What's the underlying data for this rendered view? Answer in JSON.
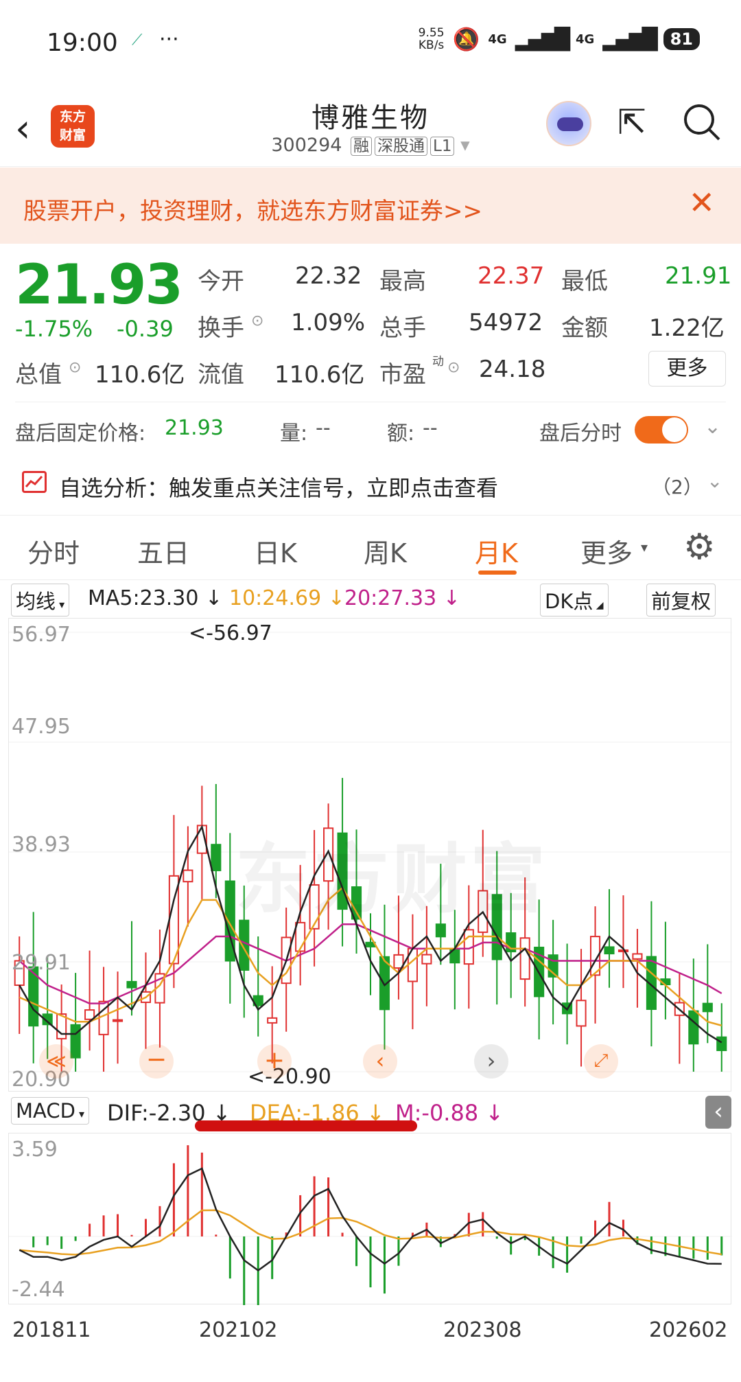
{
  "status": {
    "time": "19:00",
    "net_speed": "9.55\nKB/s",
    "sig1": "4G",
    "sig2": "4G",
    "battery": "81"
  },
  "header": {
    "name": "博雅生物",
    "code": "300294",
    "tags": [
      "融",
      "深股通",
      "L1"
    ],
    "logo_text": "东方\n财富"
  },
  "banner": {
    "text": "股票开户，投资理财，就选东方财富证券>>"
  },
  "quote": {
    "price": "21.93",
    "pct": "-1.75%",
    "chg": "-0.39",
    "open_label": "今开",
    "open": "22.32",
    "high_label": "最高",
    "high": "22.37",
    "low_label": "最低",
    "low": "21.91",
    "turnover_label": "换手",
    "turnover": "1.09%",
    "volume_label": "总手",
    "volume": "54972",
    "amount_label": "金额",
    "amount": "1.22亿",
    "mcap_label": "总值",
    "mcap": "110.6亿",
    "float_label": "流值",
    "float": "110.6亿",
    "pe_label": "市盈",
    "pe_sup": "动",
    "pe": "24.18",
    "more": "更多"
  },
  "after_hours": {
    "label": "盘后固定价格:",
    "price": "21.93",
    "vol_label": "量:",
    "vol": "--",
    "amt_label": "额:",
    "amt": "--",
    "toggle_label": "盘后分时"
  },
  "analysis": {
    "text": "自选分析：触发重点关注信号，立即点击查看",
    "count": "（2）"
  },
  "tabs": [
    "分时",
    "五日",
    "日K",
    "周K",
    "月K",
    "更多"
  ],
  "active_tab": "月K",
  "ma_bar": {
    "selector": "均线",
    "ma5": "MA5:23.30 ↓",
    "ma10": "10:24.69 ↓",
    "ma20": "20:27.33 ↓",
    "dk": "DK点",
    "fq": "前复权"
  },
  "price_axis": [
    "56.97",
    "47.95",
    "38.93",
    "29.91",
    "20.90"
  ],
  "annotations": {
    "high": "<-56.97",
    "low": "<-20.90"
  },
  "watermark": "东方财富",
  "macd_bar": {
    "selector": "MACD",
    "dif": "DIF:-2.30 ↓",
    "dea": "DEA:-1.86 ↓",
    "m": "M:-0.88 ↓"
  },
  "macd_axis": [
    "3.59",
    "-2.44"
  ],
  "x_axis": [
    "201811",
    "202102",
    "202308",
    "202602"
  ],
  "colors": {
    "up": "#e03030",
    "down": "#1a9e2a",
    "ma5": "#222222",
    "ma10": "#e8a020",
    "ma20": "#c0208a",
    "accent": "#f06a1a"
  },
  "chart_data": {
    "type": "candlestick",
    "ylim": [
      20.9,
      56.97
    ],
    "ma5": [
      28,
      26,
      25,
      24,
      24,
      25,
      26,
      27,
      26,
      28,
      30,
      35,
      39,
      41,
      36,
      32,
      28,
      26,
      27,
      30,
      34,
      37,
      39,
      36,
      33,
      30,
      28,
      29,
      31,
      32,
      30,
      31,
      33,
      34,
      32,
      30,
      31,
      29,
      27,
      26,
      28,
      30,
      32,
      31,
      29,
      28,
      27,
      26,
      25,
      24,
      23.3
    ],
    "ma10": [
      27,
      26.5,
      26,
      25.5,
      25,
      25,
      25.5,
      26,
      26.5,
      27,
      28,
      30,
      33,
      35,
      35,
      33,
      31,
      29,
      28,
      29,
      31,
      33,
      35,
      36,
      34,
      32,
      30,
      29,
      30,
      31,
      31,
      31,
      32,
      32,
      32,
      31,
      31,
      30,
      29,
      28,
      28,
      29,
      30,
      30,
      30,
      29,
      28,
      27,
      26,
      25,
      24.69
    ],
    "ma20": [
      30,
      29,
      28,
      27.5,
      27,
      26.5,
      26.5,
      27,
      27.5,
      28,
      28.5,
      29,
      30,
      31,
      32,
      32,
      31.5,
      31,
      30.5,
      30,
      30.5,
      31,
      32,
      33,
      33,
      32.5,
      32,
      31.5,
      31,
      31,
      31,
      31,
      31,
      31.5,
      31.5,
      31,
      31,
      30.5,
      30,
      30,
      30,
      30,
      30,
      30,
      30,
      30,
      29.5,
      29,
      28.5,
      28,
      27.33
    ]
  }
}
